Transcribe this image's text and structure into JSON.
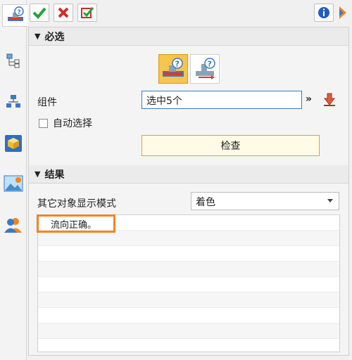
{
  "toolbar": {
    "ok_icon": "check-icon",
    "cancel_icon": "cross-icon",
    "apply_icon": "apply-check-icon",
    "info_icon": "info-icon",
    "help_icon": "help-icon"
  },
  "left_tabs": [
    {
      "icon": "flow-check-icon"
    },
    {
      "icon": "tree-structure-icon"
    },
    {
      "icon": "hierarchy-icon"
    },
    {
      "icon": "cube-icon"
    },
    {
      "icon": "image-view-icon"
    },
    {
      "icon": "user-icon"
    }
  ],
  "required": {
    "header": "必选",
    "component_label": "组件",
    "component_value": "选中5个",
    "auto_select_label": "自动选择",
    "auto_select_checked": false,
    "check_button": "检查"
  },
  "results": {
    "header": "结果",
    "display_mode_label": "其它对象显示模式",
    "display_mode_value": "着色",
    "rows": [
      "流向正确。",
      "",
      "",
      "",
      "",
      "",
      "",
      "",
      ""
    ]
  },
  "colors": {
    "accent_orange": "#f0861f",
    "selected_mode_bg": "#f7c54a",
    "input_border": "#3a78c8"
  }
}
